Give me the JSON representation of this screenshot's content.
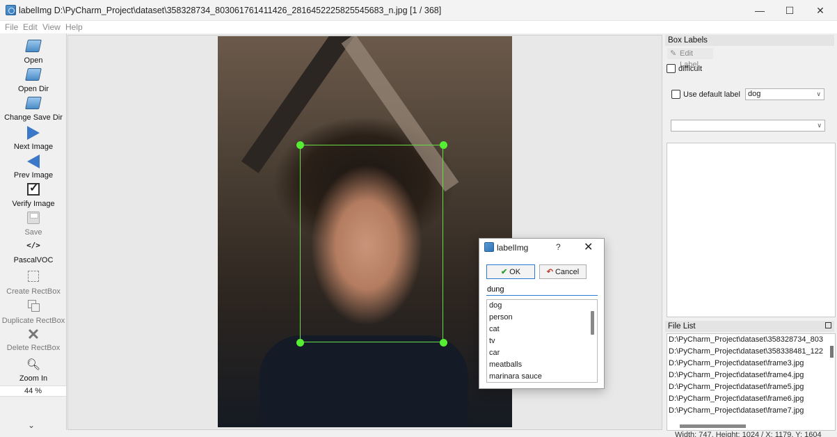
{
  "window": {
    "title": "labelImg D:\\PyCharm_Project\\dataset\\358328734_803061761411426_2816452225825545683_n.jpg [1 / 368]",
    "minimize": "—",
    "maximize": "☐",
    "close": "✕"
  },
  "menu": [
    "File",
    "Edit",
    "View",
    "Help"
  ],
  "toolbar": {
    "open": "Open",
    "open_dir": "Open Dir",
    "change_save_dir": "Change Save Dir",
    "next_image": "Next Image",
    "prev_image": "Prev Image",
    "verify_image": "Verify Image",
    "save": "Save",
    "format_icon": "</>",
    "format": "PascalVOC",
    "create_rectbox": "Create RectBox",
    "duplicate_rectbox": "Duplicate RectBox",
    "delete_rectbox": "Delete RectBox",
    "zoom_in": "Zoom In",
    "zoom_value": "44 %",
    "more": "⌄"
  },
  "dialog": {
    "title": "labelImg",
    "help": "?",
    "close": "✕",
    "ok": "OK",
    "cancel": "Cancel",
    "input_value": "dung",
    "labels": [
      "dog",
      "person",
      "cat",
      "tv",
      "car",
      "meatballs",
      "marinara sauce"
    ]
  },
  "right_panel": {
    "box_labels_header": "Box Labels",
    "edit_label": "Edit Label",
    "difficult": "difficult",
    "use_default_label": "Use default label",
    "default_label_value": "dog",
    "file_list_header": "File List",
    "files": [
      "D:\\PyCharm_Project\\dataset\\358328734_803",
      "D:\\PyCharm_Project\\dataset\\358338481_122",
      "D:\\PyCharm_Project\\dataset\\frame3.jpg",
      "D:\\PyCharm_Project\\dataset\\frame4.jpg",
      "D:\\PyCharm_Project\\dataset\\frame5.jpg",
      "D:\\PyCharm_Project\\dataset\\frame6.jpg",
      "D:\\PyCharm_Project\\dataset\\frame7.jpg"
    ]
  },
  "status": "Width: 747, Height: 1024 / X: 1179, Y: 1604"
}
